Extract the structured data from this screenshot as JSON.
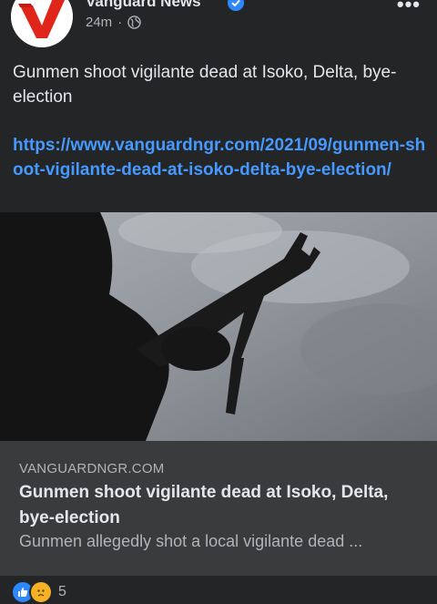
{
  "header": {
    "page_name": "Vanguard News",
    "time": "24m",
    "separator": "·",
    "more_label": "•••"
  },
  "post": {
    "text": "Gunmen shoot vigilante dead at Isoko, Delta, bye-election",
    "link": "https://www.vanguardngr.com/2021/09/gunmen-shoot-vigilante-dead-at-isoko-delta-bye-election/"
  },
  "card": {
    "domain": "VANGUARDNGR.COM",
    "title": "Gunmen shoot vigilante dead at Isoko, Delta, bye-election",
    "description": "Gunmen allegedly shot a local vigilante dead ..."
  },
  "reactions": {
    "count": "5",
    "types": [
      "like-icon",
      "sad-icon"
    ]
  },
  "colors": {
    "background": "#242526",
    "link": "#4599ff",
    "card": "#3a3b3c",
    "brand_red": "#e0251b"
  }
}
